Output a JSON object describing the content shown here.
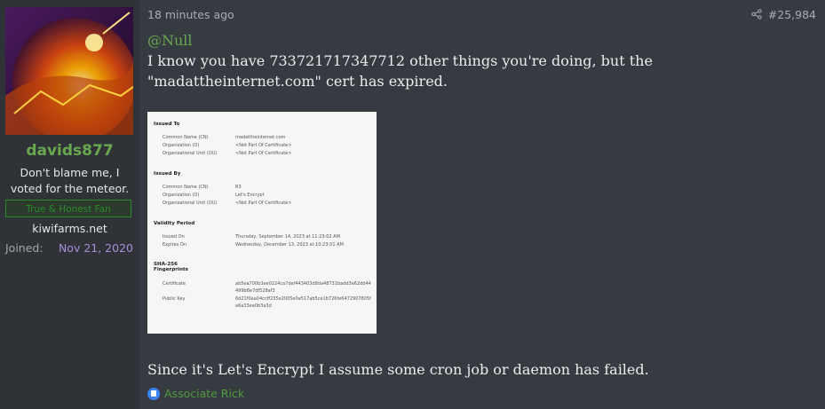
{
  "user": {
    "username": "davids877",
    "title": "Don't blame me, I voted for the meteor.",
    "banner": "True & Honest Fan",
    "site": "kiwifarms.net",
    "joined_label": "Joined:",
    "joined_date": "Nov 21, 2020"
  },
  "post": {
    "time": "18 minutes ago",
    "number": "#25,984",
    "mention": "@Null",
    "text": "I know you have 733721717347712 other things you're doing, but the \"madattheinternet.com\" cert has expired.",
    "after_text": "Since it's Let's Encrypt I assume some cron job or daemon has failed."
  },
  "certificate": {
    "issued_to_heading": "Issued To",
    "issued_to": [
      {
        "k": "Common Name (CN)",
        "v": "madattheinternet.com"
      },
      {
        "k": "Organization (O)",
        "v": "<Not Part Of Certificate>"
      },
      {
        "k": "Organizational Unit (OU)",
        "v": "<Not Part Of Certificate>"
      }
    ],
    "issued_by_heading": "Issued By",
    "issued_by": [
      {
        "k": "Common Name (CN)",
        "v": "R3"
      },
      {
        "k": "Organization (O)",
        "v": "Let's Encrypt"
      },
      {
        "k": "Organizational Unit (OU)",
        "v": "<Not Part Of Certificate>"
      }
    ],
    "validity_heading": "Validity Period",
    "validity": [
      {
        "k": "Issued On",
        "v": "Thursday, September 14, 2023 at 11:23:02 AM"
      },
      {
        "k": "Expires On",
        "v": "Wednesday, December 13, 2023 at 10:23:01 AM"
      }
    ],
    "fingerprint_heading_1": "SHA-256",
    "fingerprint_heading_2": "Fingerprints",
    "cert_label": "Certificate",
    "cert_line1": "ab5ea700b3ee0224ca7def443403d8da48731badd3e62dd44",
    "cert_line2": "499b8e7df528af3",
    "pubkey_label": "Public Key",
    "pubkey_line1": "6d21f0aa04ccff235e2005e0e517ab5ce1b726fe6472907805f",
    "pubkey_line2": "a6a33ea0b3a3d"
  },
  "reactions": {
    "names": "Associate Rick"
  },
  "colors": {
    "background": "#363b41",
    "sidebar": "#2f3338",
    "username": "#6aa84f",
    "joined_date": "#a88fd8"
  }
}
